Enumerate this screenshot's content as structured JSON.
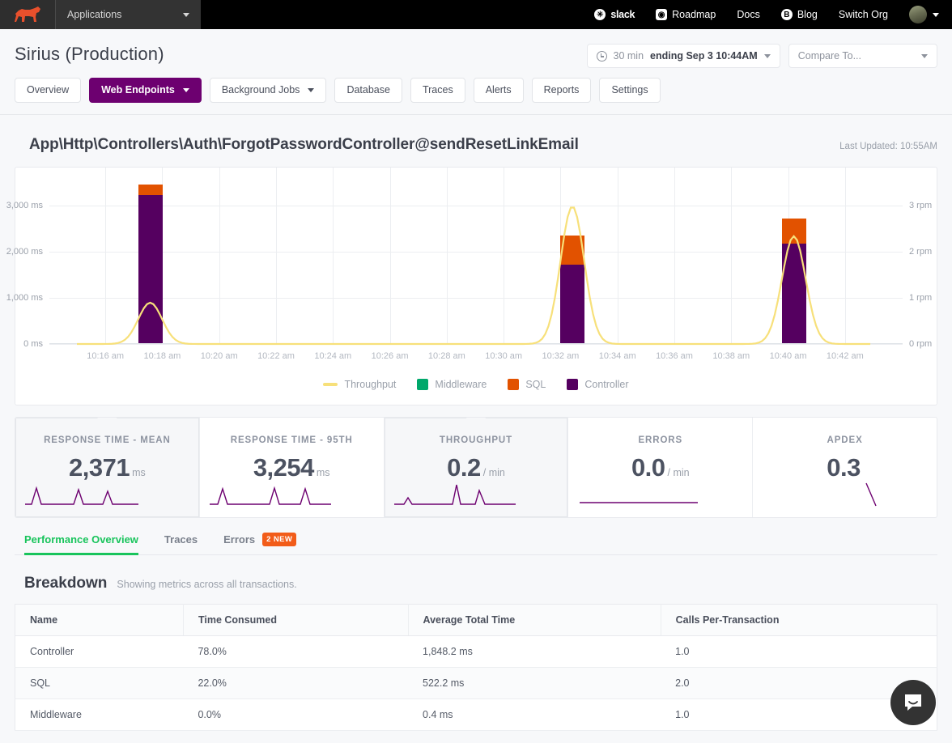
{
  "topnav": {
    "logo_icon": "dog-logo-icon",
    "applications_label": "Applications",
    "items": [
      {
        "label": "slack",
        "icon": "slack-icon"
      },
      {
        "label": "Roadmap",
        "icon": "roadmap-icon"
      },
      {
        "label": "Docs",
        "icon": ""
      },
      {
        "label": "Blog",
        "icon": "blog-icon"
      },
      {
        "label": "Switch Org",
        "icon": ""
      }
    ]
  },
  "header": {
    "app_title": "Sirius (Production)",
    "subnav": [
      {
        "label": "Overview",
        "active": false,
        "dropdown": false
      },
      {
        "label": "Web Endpoints",
        "active": true,
        "dropdown": true
      },
      {
        "label": "Background Jobs",
        "active": false,
        "dropdown": true
      },
      {
        "label": "Database",
        "active": false,
        "dropdown": false
      },
      {
        "label": "Traces",
        "active": false,
        "dropdown": false
      },
      {
        "label": "Alerts",
        "active": false,
        "dropdown": false
      },
      {
        "label": "Reports",
        "active": false,
        "dropdown": false
      },
      {
        "label": "Settings",
        "active": false,
        "dropdown": false
      }
    ],
    "time_range_prefix": "30 min",
    "time_range_value": "ending Sep 3 10:44AM",
    "compare_label": "Compare To..."
  },
  "endpoint": {
    "name": "App\\Http\\Controllers\\Auth\\ForgotPasswordController@sendResetLinkEmail",
    "last_updated": "Last Updated: 10:55AM"
  },
  "chart_data": {
    "type": "bar",
    "title": "",
    "xlabel": "",
    "ylabel": "ms",
    "y2label": "rpm",
    "grid": true,
    "legend_position": "bottom",
    "ylim": [
      0,
      3600
    ],
    "y2lim": [
      0,
      3.6
    ],
    "yticks": [
      0,
      1000,
      2000,
      3000
    ],
    "ytick_labels": [
      "0 ms",
      "1,000 ms",
      "2,000 ms",
      "3,000 ms"
    ],
    "y2ticks": [
      0,
      1,
      2,
      3
    ],
    "y2tick_labels": [
      "0 rpm",
      "1 rpm",
      "2 rpm",
      "3 rpm"
    ],
    "xtick_labels": [
      "10:16 am",
      "10:18 am",
      "10:20 am",
      "10:22 am",
      "10:24 am",
      "10:26 am",
      "10:28 am",
      "10:30 am",
      "10:32 am",
      "10:34 am",
      "10:36 am",
      "10:38 am",
      "10:40 am",
      "10:42 am"
    ],
    "legend": [
      {
        "name": "Throughput",
        "color": "#f7e07a",
        "style": "line"
      },
      {
        "name": "Middleware",
        "color": "#00a86b",
        "style": "bar"
      },
      {
        "name": "SQL",
        "color": "#e25200",
        "style": "bar"
      },
      {
        "name": "Controller",
        "color": "#550060",
        "style": "bar"
      }
    ],
    "bars": [
      {
        "x_label": "10:16 am",
        "x_pct": 9.2,
        "controller": 3230,
        "sql": 230,
        "middleware": 0
      },
      {
        "x_label": "10:31 am",
        "x_pct": 62.2,
        "controller": 1720,
        "sql": 630,
        "middleware": 0
      },
      {
        "x_label": "10:39 am",
        "x_pct": 90.0,
        "controller": 2180,
        "sql": 540,
        "middleware": 0
      }
    ],
    "throughput_peaks": [
      {
        "x_pct": 9.2,
        "value": 0.9
      },
      {
        "x_pct": 62.2,
        "value": 3.0
      },
      {
        "x_pct": 90.0,
        "value": 2.35
      }
    ]
  },
  "metric_cards": [
    {
      "label": "RESPONSE TIME - MEAN",
      "value": "2,371",
      "unit": "ms",
      "selected": true
    },
    {
      "label": "RESPONSE TIME - 95TH",
      "value": "3,254",
      "unit": "ms",
      "selected": false
    },
    {
      "label": "THROUGHPUT",
      "value": "0.2",
      "unit": "/ min",
      "selected": true
    },
    {
      "label": "ERRORS",
      "value": "0.0",
      "unit": "/ min",
      "selected": false
    },
    {
      "label": "APDEX",
      "value": "0.3",
      "unit": "",
      "selected": false
    }
  ],
  "tabs": [
    {
      "label": "Performance Overview",
      "active": true,
      "badge": ""
    },
    {
      "label": "Traces",
      "active": false,
      "badge": ""
    },
    {
      "label": "Errors",
      "active": false,
      "badge": "2 NEW"
    }
  ],
  "breakdown": {
    "title": "Breakdown",
    "subtitle": "Showing metrics across all transactions.",
    "columns": [
      "Name",
      "Time Consumed",
      "Average Total Time",
      "Calls Per-Transaction"
    ],
    "rows": [
      [
        "Controller",
        "78.0%",
        "1,848.2 ms",
        "1.0"
      ],
      [
        "SQL",
        "22.0%",
        "522.2 ms",
        "2.0"
      ],
      [
        "Middleware",
        "0.0%",
        "0.4 ms",
        "1.0"
      ]
    ]
  },
  "colors": {
    "accent_purple": "#6d0070",
    "bar_controller": "#550060",
    "bar_sql": "#e25200",
    "bar_middleware": "#00a86b",
    "throughput_line": "#f7e07a",
    "tab_active": "#19c45c",
    "badge": "#f25c19"
  },
  "intercom": {
    "icon": "intercom-messenger-icon"
  }
}
